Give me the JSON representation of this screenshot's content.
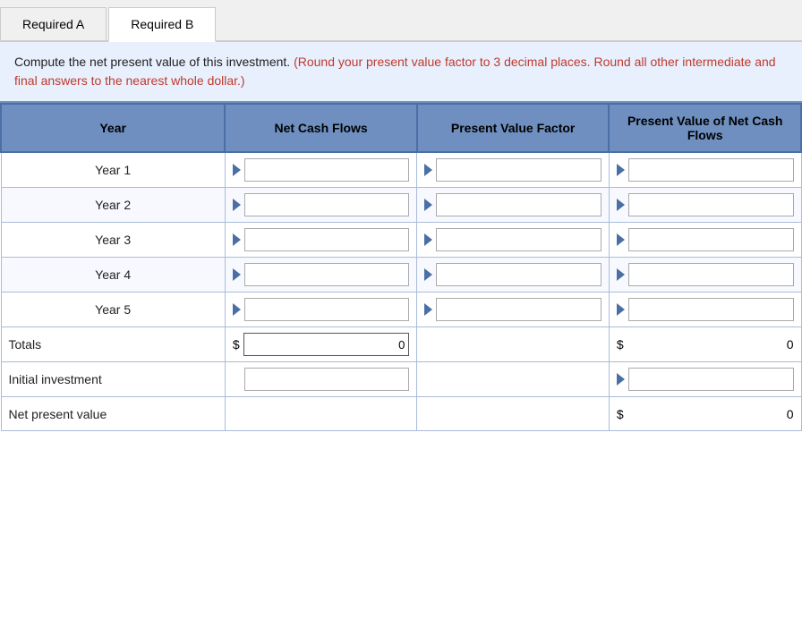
{
  "tabs": [
    {
      "label": "Required A",
      "active": false
    },
    {
      "label": "Required B",
      "active": true
    }
  ],
  "instruction": {
    "main": "Compute the net present value of this investment.",
    "red": "(Round your present value factor to 3 decimal places. Round all other intermediate and final answers to the nearest whole dollar.)"
  },
  "table": {
    "headers": [
      "Year",
      "Net Cash Flows",
      "Present Value Factor",
      "Present Value of Net Cash Flows"
    ],
    "year_rows": [
      {
        "label": "Year 1"
      },
      {
        "label": "Year 2"
      },
      {
        "label": "Year 3"
      },
      {
        "label": "Year 4"
      },
      {
        "label": "Year 5"
      }
    ],
    "totals_row": {
      "label": "Totals",
      "net_cash_dollar": "$",
      "net_cash_value": "0",
      "pv_dollar": "$",
      "pv_value": "0"
    },
    "initial_row": {
      "label": "Initial investment"
    },
    "npv_row": {
      "label": "Net present value",
      "dollar": "$",
      "value": "0"
    }
  }
}
